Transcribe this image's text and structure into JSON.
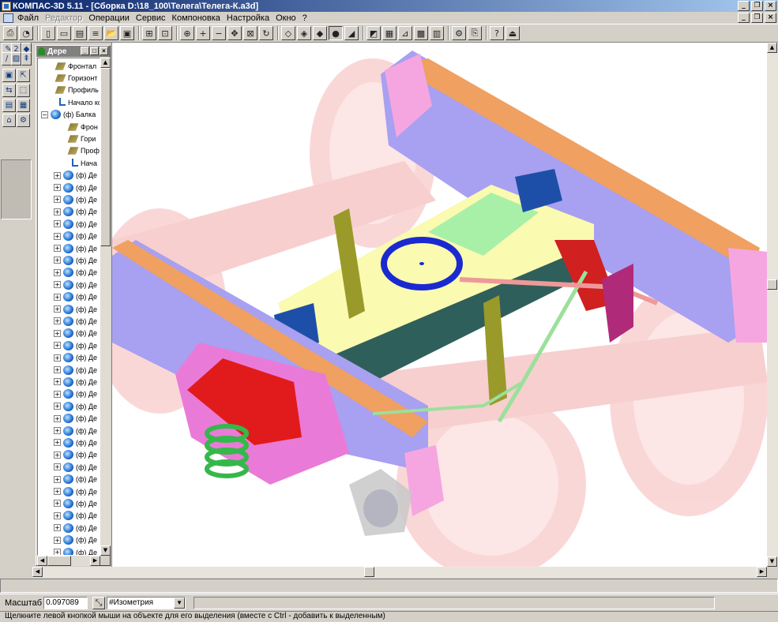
{
  "title": "КОМПАС-3D 5.11 - [Сборка D:\\18_100\\Телега\\Телега-К.a3d]",
  "menu": [
    "Файл",
    "Редактор",
    "Операции",
    "Сервис",
    "Компоновка",
    "Настройка",
    "Окно",
    "?"
  ],
  "menu_disabled": [
    "Редактор"
  ],
  "toolbar_icons": [
    "print-icon",
    "preview-icon",
    "new-icon",
    "new-sheet-icon",
    "new-fragment-icon",
    "new-text-icon",
    "open-icon",
    "save-icon",
    "grid-icon",
    "snap-icon",
    "zoom-window-icon",
    "zoom-in-icon",
    "zoom-out-icon",
    "pan-icon",
    "fit-icon",
    "rotate-icon",
    "wireframe-icon",
    "hidden-lines-icon",
    "thin-hidden-icon",
    "shaded-icon",
    "perspective-icon",
    "section-icon",
    "properties-icon",
    "measure-icon",
    "mass-icon",
    "library-icon",
    "manager-icon",
    "preview-2-icon",
    "help-icon",
    "exit-icon"
  ],
  "tree": {
    "header": "Дере",
    "items": [
      {
        "level": 1,
        "icon": "plane",
        "label": "Фронтал"
      },
      {
        "level": 1,
        "icon": "plane",
        "label": "Горизонт"
      },
      {
        "level": 1,
        "icon": "plane",
        "label": "Профиль"
      },
      {
        "level": 1,
        "icon": "origin",
        "label": "Начало ко"
      },
      {
        "level": 0,
        "icon": "part",
        "expander": "−",
        "label": "(ф) Балка"
      },
      {
        "level": 2,
        "icon": "plane",
        "label": "Фрон"
      },
      {
        "level": 2,
        "icon": "plane",
        "label": "Гори"
      },
      {
        "level": 2,
        "icon": "plane",
        "label": "Проф"
      },
      {
        "level": 2,
        "icon": "origin",
        "label": "Нача"
      },
      {
        "level": 1,
        "icon": "part",
        "expander": "+",
        "label": "(ф) Де"
      },
      {
        "level": 1,
        "icon": "part",
        "expander": "+",
        "label": "(ф) Де"
      },
      {
        "level": 1,
        "icon": "part",
        "expander": "+",
        "label": "(ф) Де"
      },
      {
        "level": 1,
        "icon": "part",
        "expander": "+",
        "label": "(ф) Де"
      },
      {
        "level": 1,
        "icon": "part",
        "expander": "+",
        "label": "(ф) Де"
      },
      {
        "level": 1,
        "icon": "part",
        "expander": "+",
        "label": "(ф) Де"
      },
      {
        "level": 1,
        "icon": "part",
        "expander": "+",
        "label": "(ф) Де"
      },
      {
        "level": 1,
        "icon": "part",
        "expander": "+",
        "label": "(ф) Де"
      },
      {
        "level": 1,
        "icon": "part",
        "expander": "+",
        "label": "(ф) Де"
      },
      {
        "level": 1,
        "icon": "part",
        "expander": "+",
        "label": "(ф) Де"
      },
      {
        "level": 1,
        "icon": "part",
        "expander": "+",
        "label": "(ф) Де"
      },
      {
        "level": 1,
        "icon": "part",
        "expander": "+",
        "label": "(ф) Де"
      },
      {
        "level": 1,
        "icon": "part",
        "expander": "+",
        "label": "(ф) Де"
      },
      {
        "level": 1,
        "icon": "part",
        "expander": "+",
        "label": "(ф) Де"
      },
      {
        "level": 1,
        "icon": "part",
        "expander": "+",
        "label": "(ф) Де"
      },
      {
        "level": 1,
        "icon": "part",
        "expander": "+",
        "label": "(ф) Де"
      },
      {
        "level": 1,
        "icon": "part",
        "expander": "+",
        "label": "(ф) Де"
      },
      {
        "level": 1,
        "icon": "part",
        "expander": "+",
        "label": "(ф) Де"
      },
      {
        "level": 1,
        "icon": "part",
        "expander": "+",
        "label": "(ф) Де"
      },
      {
        "level": 1,
        "icon": "part",
        "expander": "+",
        "label": "(ф) Де"
      },
      {
        "level": 1,
        "icon": "part",
        "expander": "+",
        "label": "(ф) Де"
      },
      {
        "level": 1,
        "icon": "part",
        "expander": "+",
        "label": "(ф) Де"
      },
      {
        "level": 1,
        "icon": "part",
        "expander": "+",
        "label": "(ф) Де"
      },
      {
        "level": 1,
        "icon": "part",
        "expander": "+",
        "label": "(ф) Де"
      },
      {
        "level": 1,
        "icon": "part",
        "expander": "+",
        "label": "(ф) Де"
      },
      {
        "level": 1,
        "icon": "part",
        "expander": "+",
        "label": "(ф) Де"
      },
      {
        "level": 1,
        "icon": "part",
        "expander": "+",
        "label": "(ф) Де"
      },
      {
        "level": 1,
        "icon": "part",
        "expander": "+",
        "label": "(ф) Де"
      },
      {
        "level": 1,
        "icon": "part",
        "expander": "+",
        "label": "(ф) Де"
      },
      {
        "level": 1,
        "icon": "part",
        "expander": "+",
        "label": "(ф) Де"
      },
      {
        "level": 1,
        "icon": "part",
        "expander": "+",
        "label": "(ф) Де"
      },
      {
        "level": 1,
        "icon": "part",
        "expander": "+",
        "label": "(ф) Де"
      }
    ]
  },
  "status": {
    "scale_label": "Масштаб",
    "scale_value": "0.097089",
    "view_value": "#Изометрия",
    "hint": "Щелкните левой кнопкой мыши на объекте для его выделения (вместе с Ctrl - добавить к выделенным)"
  }
}
